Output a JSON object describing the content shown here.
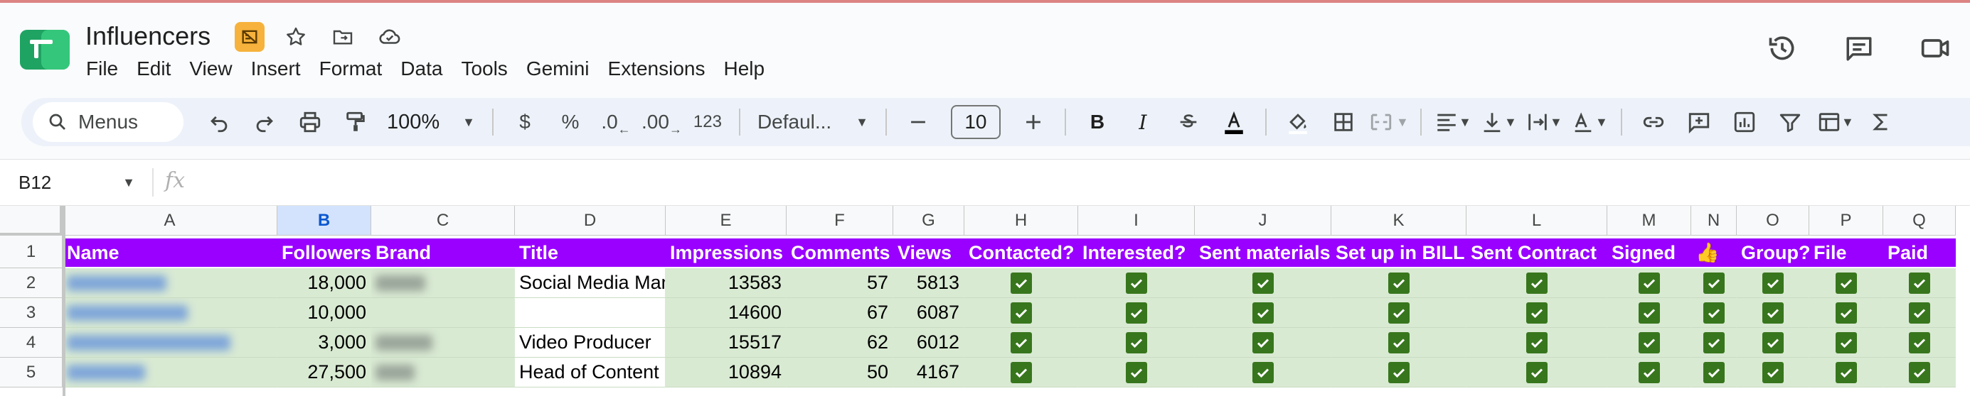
{
  "doc": {
    "title": "Influencers"
  },
  "menu": [
    "File",
    "Edit",
    "View",
    "Insert",
    "Format",
    "Data",
    "Tools",
    "Gemini",
    "Extensions",
    "Help"
  ],
  "toolbar": {
    "search_label": "Menus",
    "zoom": "100%",
    "currency": "$",
    "percent": "%",
    "dec_decrease": ".0",
    "dec_increase": ".00",
    "number_format": "123",
    "font": "Defaul...",
    "font_size": "10",
    "bold": "B",
    "italic": "I"
  },
  "formula_bar": {
    "cell_ref": "B12",
    "fx": "fx",
    "content": ""
  },
  "columns": [
    {
      "letter": "A",
      "selected": false
    },
    {
      "letter": "B",
      "selected": true
    },
    {
      "letter": "C",
      "selected": false
    },
    {
      "letter": "D",
      "selected": false
    },
    {
      "letter": "E",
      "selected": false
    },
    {
      "letter": "F",
      "selected": false
    },
    {
      "letter": "G",
      "selected": false
    },
    {
      "letter": "H",
      "selected": false
    },
    {
      "letter": "I",
      "selected": false
    },
    {
      "letter": "J",
      "selected": false
    },
    {
      "letter": "K",
      "selected": false
    },
    {
      "letter": "L",
      "selected": false
    },
    {
      "letter": "M",
      "selected": false
    },
    {
      "letter": "N",
      "selected": false
    },
    {
      "letter": "O",
      "selected": false
    },
    {
      "letter": "P",
      "selected": false
    },
    {
      "letter": "Q",
      "selected": false
    }
  ],
  "row_numbers": [
    "1",
    "2",
    "3",
    "4",
    "5"
  ],
  "header_row": [
    "Name",
    "Followers",
    "Brand",
    "Title",
    "Impressions",
    "Comments",
    "Views",
    "Contacted?",
    "Interested?",
    "Sent materials",
    "Set up in BILL",
    "Sent Contract",
    "Signed",
    "👍",
    "Group?",
    "File",
    "Paid"
  ],
  "rows": [
    {
      "followers": "18,000",
      "title": "Social Media Manager",
      "impressions": "13583",
      "comments": "57",
      "views": "5813",
      "checks": [
        true,
        true,
        true,
        true,
        true,
        true,
        true,
        true,
        true,
        true
      ]
    },
    {
      "followers": "10,000",
      "title": "",
      "impressions": "14600",
      "comments": "67",
      "views": "6087",
      "checks": [
        true,
        true,
        true,
        true,
        true,
        true,
        true,
        true,
        true,
        true
      ]
    },
    {
      "followers": "3,000",
      "title": "Video Producer",
      "impressions": "15517",
      "comments": "62",
      "views": "6012",
      "checks": [
        true,
        true,
        true,
        true,
        true,
        true,
        true,
        true,
        true,
        true
      ]
    },
    {
      "followers": "27,500",
      "title": "Head of Content",
      "impressions": "10894",
      "comments": "50",
      "views": "4167",
      "checks": [
        true,
        true,
        true,
        true,
        true,
        true,
        true,
        true,
        true,
        true
      ]
    }
  ],
  "colors": {
    "header_purple": "#9900ff",
    "row_green": "#d9ead3",
    "check_green": "#38761d",
    "selected_col": "#d3e3fd"
  }
}
